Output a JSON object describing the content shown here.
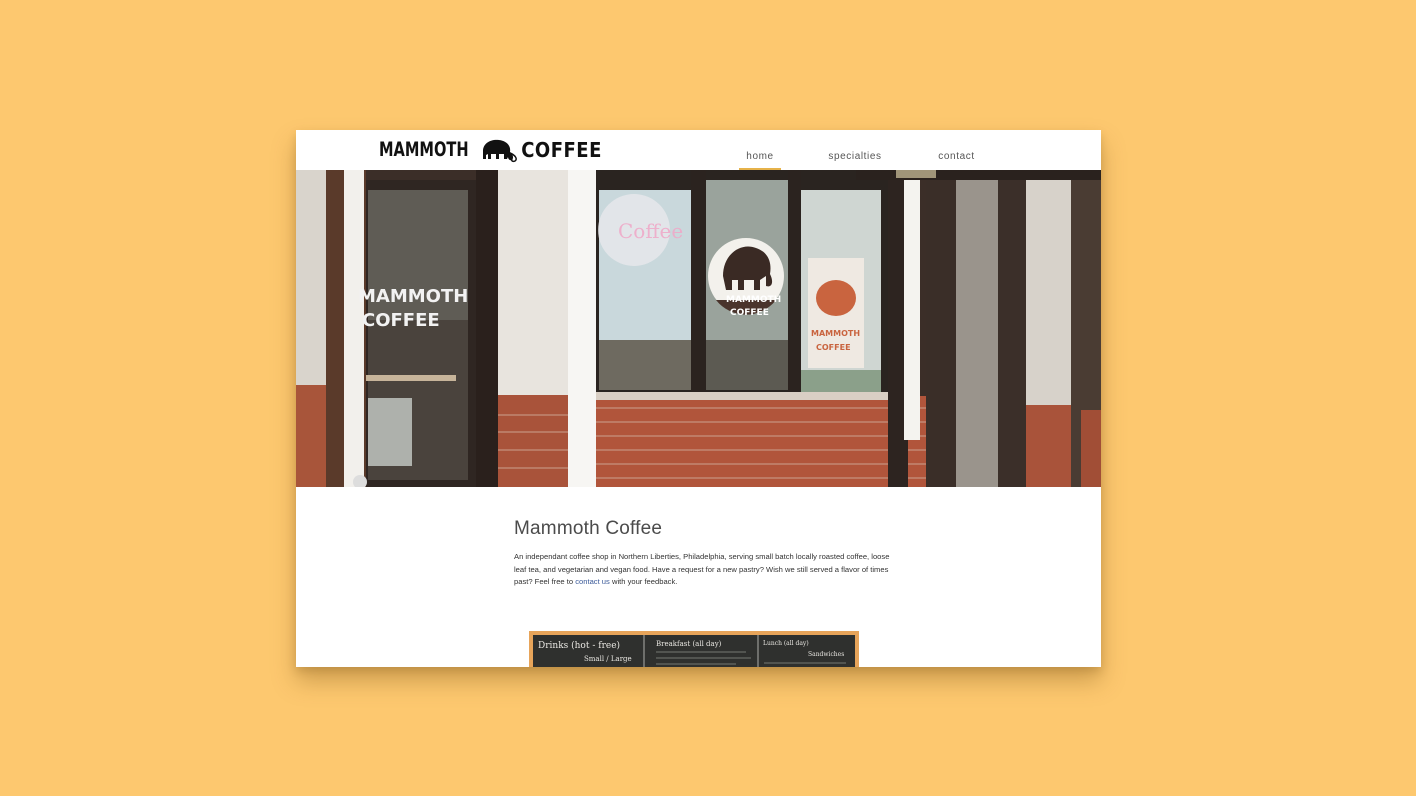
{
  "background_color": "#fdc86f",
  "header": {
    "logo": {
      "word1": "MAMMOTH",
      "word2": "COFFEE",
      "icon": "mammoth-icon"
    },
    "nav": [
      {
        "label": "home",
        "active": true
      },
      {
        "label": "specialties",
        "active": false
      },
      {
        "label": "contact",
        "active": false
      }
    ]
  },
  "hero": {
    "sign_left_line1": "MAMMOTH",
    "sign_left_line2": "COFFEE",
    "window_logo_line1": "MAMMOTH",
    "window_logo_line2": "COFFEE",
    "poster_line1": "MAMMOTH",
    "poster_line2": "COFFEE"
  },
  "main": {
    "title": "Mammoth Coffee",
    "description_before": "An independant coffee shop in Northern Liberties, Philadelphia, serving small batch locally roasted coffee, loose leaf tea, and vegetarian and vegan food. Have a request for a new pastry? Wish we still served a flavor of times past? Feel free to ",
    "contact_link": "contact us",
    "description_after": " with your feedback."
  },
  "menu_board": {
    "col1_heading": "Drinks (hot - free)",
    "col1_sub": "Small / Large",
    "col2_heading": "Breakfast (all day)",
    "col3_heading": "Lunch (all day)",
    "col3_sub": "Sandwiches"
  },
  "colors": {
    "accent": "#e6b24a",
    "link": "#3b5a99",
    "brick": "#b85a3a"
  }
}
